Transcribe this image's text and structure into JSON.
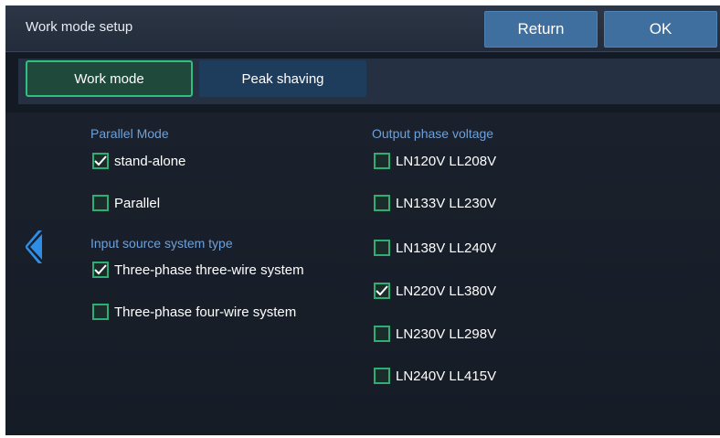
{
  "header": {
    "title": "Work mode setup",
    "return_label": "Return",
    "ok_label": "OK"
  },
  "tabs": [
    {
      "label": "Work mode",
      "active": true
    },
    {
      "label": "Peak shaving",
      "active": false
    }
  ],
  "parallel_mode": {
    "title": "Parallel Mode",
    "options": [
      {
        "label": "stand-alone",
        "checked": true
      },
      {
        "label": "Parallel",
        "checked": false
      }
    ]
  },
  "input_source": {
    "title": "Input source system type",
    "options": [
      {
        "label": "Three-phase three-wire system",
        "checked": true
      },
      {
        "label": "Three-phase four-wire system",
        "checked": false
      }
    ]
  },
  "output_voltage": {
    "title": "Output phase voltage",
    "options": [
      {
        "label": "LN120V LL208V",
        "checked": false
      },
      {
        "label": "LN133V LL230V",
        "checked": false
      },
      {
        "label": "LN138V LL240V",
        "checked": false
      },
      {
        "label": "LN220V LL380V",
        "checked": true
      },
      {
        "label": "LN230V LL298V",
        "checked": false
      },
      {
        "label": "LN240V LL415V",
        "checked": false
      }
    ]
  },
  "icons": {
    "nav_left": "chevron-left-icon",
    "check": "checkmark-icon"
  },
  "colors": {
    "accent_green": "#2fbf7e",
    "button_blue": "#3f6f9f",
    "section_title": "#6fa0d8",
    "nav_arrow": "#2e8ee6"
  }
}
